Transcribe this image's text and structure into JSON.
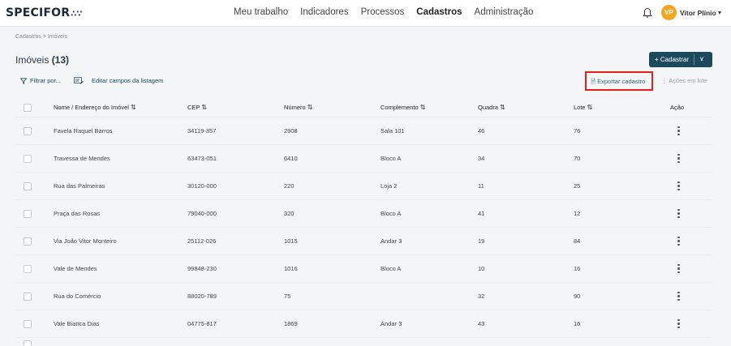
{
  "app": {
    "logo": "SPECIFOR",
    "logo_dots": "∴∵"
  },
  "nav": [
    "Meu trabalho",
    "Indicadores",
    "Processos",
    "Cadastros",
    "Administração"
  ],
  "user": {
    "initials": "VP",
    "name": "Vitor Plínio"
  },
  "breadcrumb": "Cadastros > Imóveis",
  "page": {
    "title": "Imóveis",
    "count": "(13)"
  },
  "actions": {
    "cadastrar": "+ Cadastrar",
    "filter": "Filtrar por...",
    "edit_fields": "Editar campos da listagem",
    "export": "Exportar cadastro",
    "bulk": "Ações em lote"
  },
  "table": {
    "headers": [
      "Nome / Endereço do Imóvel",
      "CEP",
      "Número",
      "Complemento",
      "Quadra",
      "Lote",
      "Ação"
    ],
    "rows": [
      [
        "Favela Raquel Barros",
        "34119-357",
        "2908",
        "Sala 101",
        "46",
        "76"
      ],
      [
        "Travessa de Mendes",
        "63473-051",
        "6410",
        "Bloco A",
        "34",
        "70"
      ],
      [
        "Rua das Palmeiras",
        "30120-000",
        "220",
        "Loja 2",
        "11",
        "25"
      ],
      [
        "Praça das Rosas",
        "79040-000",
        "320",
        "Bloco A",
        "41",
        "12"
      ],
      [
        "Via João Vitor Monteiro",
        "25112-026",
        "1015",
        "Andar 3",
        "19",
        "84"
      ],
      [
        "Vale de Mendes",
        "99848-230",
        "1016",
        "Bloco A",
        "10",
        "16"
      ],
      [
        "Rua do Comércio",
        "88020-789",
        "75",
        "",
        "32",
        "90"
      ],
      [
        "Vale Bianca Dias",
        "04775-817",
        "1869",
        "Andar 3",
        "43",
        "16"
      ]
    ]
  }
}
